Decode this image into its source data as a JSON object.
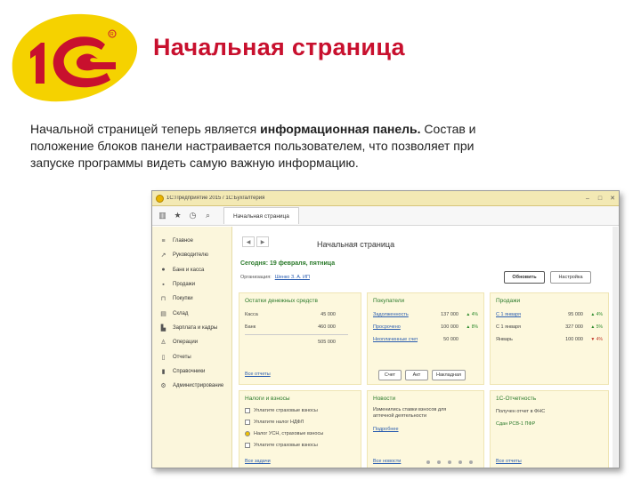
{
  "slide": {
    "title": "Начальная страница",
    "intro_before": "Начальной страницей теперь является ",
    "intro_bold": "информационная панель.",
    "intro_after": " Состав и положение блоков панели настраивается пользователем, что позволяет при запуске программы видеть самую важную информацию."
  },
  "colors": {
    "brand_red": "#c8102e",
    "brand_yellow": "#f5d200",
    "panel_bg": "#fdf8dd",
    "header_green": "#2b7a2b",
    "link_blue": "#2a5db0"
  },
  "app": {
    "window_title": "1С:Предприятие 2015 / 1С:Бухгалтерия",
    "tab_label": "Начальная страница",
    "toolbar_icons": [
      "grid-icon",
      "star-icon",
      "clock-icon",
      "search-icon"
    ],
    "sidebar": [
      {
        "icon": "menu-icon",
        "label": "Главное"
      },
      {
        "icon": "chart-icon",
        "label": "Руководителю"
      },
      {
        "icon": "coins-icon",
        "label": "Банк и касса"
      },
      {
        "icon": "bag-icon",
        "label": "Продажи"
      },
      {
        "icon": "cart-icon",
        "label": "Покупки"
      },
      {
        "icon": "warehouse-icon",
        "label": "Склад"
      },
      {
        "icon": "factory-icon",
        "label": "Зарплата и кадры"
      },
      {
        "icon": "operations-icon",
        "label": "Операции"
      },
      {
        "icon": "report-icon",
        "label": "Отчеты"
      },
      {
        "icon": "book-icon",
        "label": "Справочники"
      },
      {
        "icon": "gear-icon",
        "label": "Администрирование"
      }
    ],
    "page_heading": "Начальная страница",
    "date_text": "Сегодня: 19 февраля, пятница",
    "org_label": "Организация:",
    "org_value": "Шенко З. А. ИП",
    "btn_all": "Обновить",
    "btn_settings": "Настройка",
    "panels": {
      "money": {
        "title": "Остатки денежных средств",
        "rows": [
          {
            "name": "Касса",
            "value": "45 000"
          },
          {
            "name": "Банк",
            "value": "460 000"
          },
          {
            "name": "",
            "value": "505 000"
          }
        ],
        "link": "Все отчеты"
      },
      "buyers": {
        "title": "Покупатели",
        "rows": [
          {
            "name": "Задолженность",
            "value": "137 000",
            "delta": "▲ 4%"
          },
          {
            "name": "Просрочено",
            "value": "100 000",
            "delta": "▲ 8%"
          },
          {
            "name": "Неоплаченные счета",
            "value": "50 000",
            "delta": ""
          }
        ],
        "buttons": [
          "Счет",
          "Акт",
          "Накладная"
        ]
      },
      "sales": {
        "title": "Продажи",
        "rows": [
          {
            "name": "С 1 января",
            "value": "95 000",
            "delta": "▲ 4%"
          },
          {
            "name": "С 1 января",
            "value": "327 000",
            "delta": "▲ 5%"
          },
          {
            "name": "Январь",
            "value": "100 000",
            "delta": "▼ 4%"
          }
        ]
      },
      "taxes": {
        "title": "Налоги и взносы",
        "rows": [
          {
            "name": "Уплатите страховые взносы"
          },
          {
            "name": "Уплатите налог НДФЛ"
          },
          {
            "name": "Налог УСН, страховые взносы"
          },
          {
            "name": "Уплатите страховые взносы"
          }
        ],
        "link": "Все задачи"
      },
      "news": {
        "title": "Новости",
        "text": "Изменились ставки взносов для аптечной деятельности",
        "more": "Подробнее",
        "link": "Все новости"
      },
      "reporting": {
        "title": "1С-Отчетность",
        "line1": "Получен отчет в ФНС",
        "line2": "Сдан РСВ-1 ПФР",
        "link": "Все отчеты"
      }
    }
  }
}
